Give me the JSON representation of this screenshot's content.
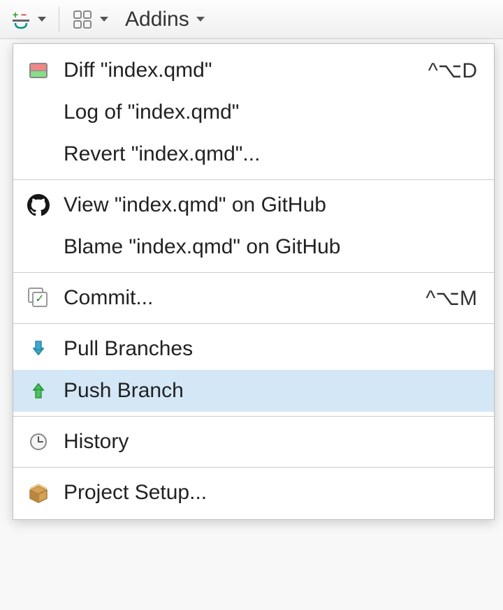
{
  "toolbar": {
    "addins_label": "Addins"
  },
  "menu": {
    "items": [
      {
        "label": "Diff \"index.qmd\"",
        "shortcut": "^⌥D"
      },
      {
        "label": "Log of \"index.qmd\"",
        "shortcut": ""
      },
      {
        "label": "Revert \"index.qmd\"...",
        "shortcut": ""
      },
      {
        "label": "View \"index.qmd\" on GitHub",
        "shortcut": ""
      },
      {
        "label": "Blame \"index.qmd\" on GitHub",
        "shortcut": ""
      },
      {
        "label": "Commit...",
        "shortcut": "^⌥M"
      },
      {
        "label": "Pull Branches",
        "shortcut": ""
      },
      {
        "label": "Push Branch",
        "shortcut": ""
      },
      {
        "label": "History",
        "shortcut": ""
      },
      {
        "label": "Project Setup...",
        "shortcut": ""
      }
    ]
  }
}
